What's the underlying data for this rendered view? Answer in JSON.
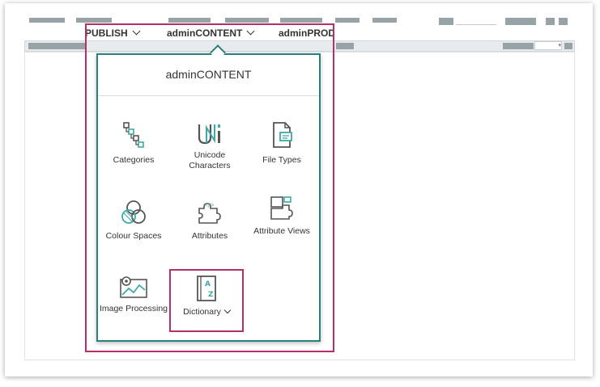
{
  "nav": {
    "items": [
      {
        "label": "PUBLISH",
        "has_chevron": true
      },
      {
        "label": "adminCONTENT",
        "has_chevron": true
      },
      {
        "label": "adminPROD",
        "has_chevron": false
      }
    ]
  },
  "menu": {
    "title": "adminCONTENT",
    "tiles": [
      {
        "label": "Categories",
        "icon": "categories-icon"
      },
      {
        "label": "Unicode Characters",
        "icon": "unicode-icon"
      },
      {
        "label": "File Types",
        "icon": "file-types-icon"
      },
      {
        "label": "Colour Spaces",
        "icon": "colour-spaces-icon"
      },
      {
        "label": "Attributes",
        "icon": "attributes-icon"
      },
      {
        "label": "Attribute Views",
        "icon": "attribute-views-icon"
      },
      {
        "label": "Image Processing",
        "icon": "image-processing-icon"
      },
      {
        "label": "Dictionary",
        "icon": "dictionary-icon",
        "has_chevron": true
      }
    ]
  },
  "colors": {
    "highlight": "#b5306a",
    "panel_border": "#2a7f7c",
    "icon_accent": "#3fa9a5",
    "icon_gray": "#555555"
  }
}
